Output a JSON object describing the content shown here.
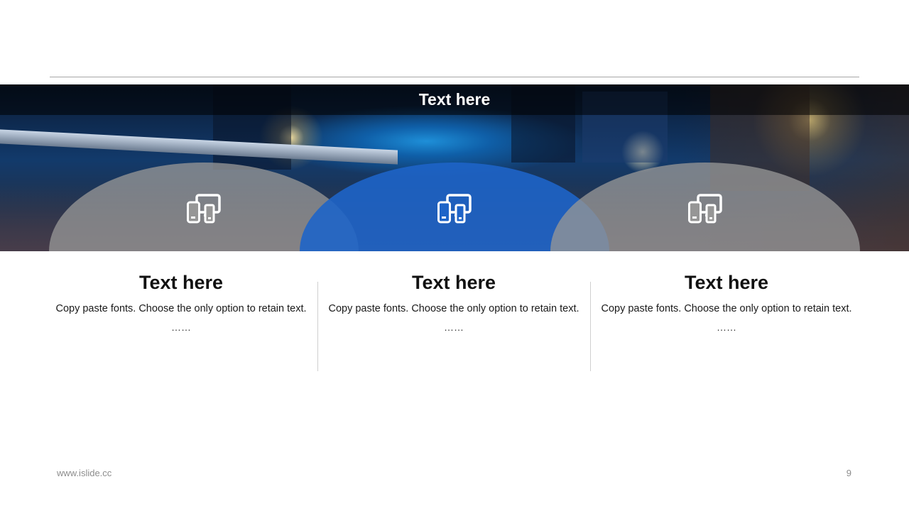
{
  "header": {
    "title": "Text here"
  },
  "columns": [
    {
      "icon": "devices-icon",
      "title": "Text here",
      "body": "Copy paste fonts. Choose the only option to retain text.",
      "ellipsis": "……"
    },
    {
      "icon": "devices-icon",
      "title": "Text here",
      "body": "Copy paste fonts. Choose the only option to retain text.",
      "ellipsis": "……"
    },
    {
      "icon": "devices-icon",
      "title": "Text here",
      "body": "Copy paste fonts. Choose the only option to retain text.",
      "ellipsis": "……"
    }
  ],
  "footer": {
    "url": "www.islide.cc",
    "page_number": "9"
  },
  "colors": {
    "accent_blue": "#1e64c8",
    "dome_grey": "#969696",
    "rule": "#a6a6a6"
  }
}
